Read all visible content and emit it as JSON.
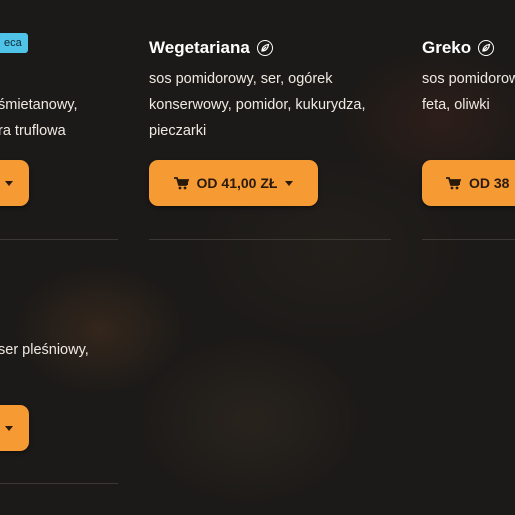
{
  "cards": [
    {
      "badge": "eca",
      "desc_lines": [
        "śmietanowy,",
        "ra truflowa"
      ]
    },
    {
      "title": "Wegetariana",
      "desc_lines": [
        "sos pomidorowy, ser, ogórek",
        "konserwowy, pomidor, kukurydza,",
        "pieczarki"
      ],
      "button_label": "OD 41,00 ZŁ"
    },
    {
      "title": "Greko",
      "desc_lines": [
        "sos pomidorow",
        "feta, oliwki"
      ],
      "button_label": "OD 38"
    },
    {
      "desc_lines": [
        "ser pleśniowy,"
      ]
    }
  ],
  "icons": {
    "vegetarian": "leaf-icon",
    "cart": "cart-icon",
    "dropdown": "caret-down-icon"
  },
  "colors": {
    "button": "#f69a34",
    "badge": "#4fc3e8",
    "background": "#1c1a18"
  }
}
